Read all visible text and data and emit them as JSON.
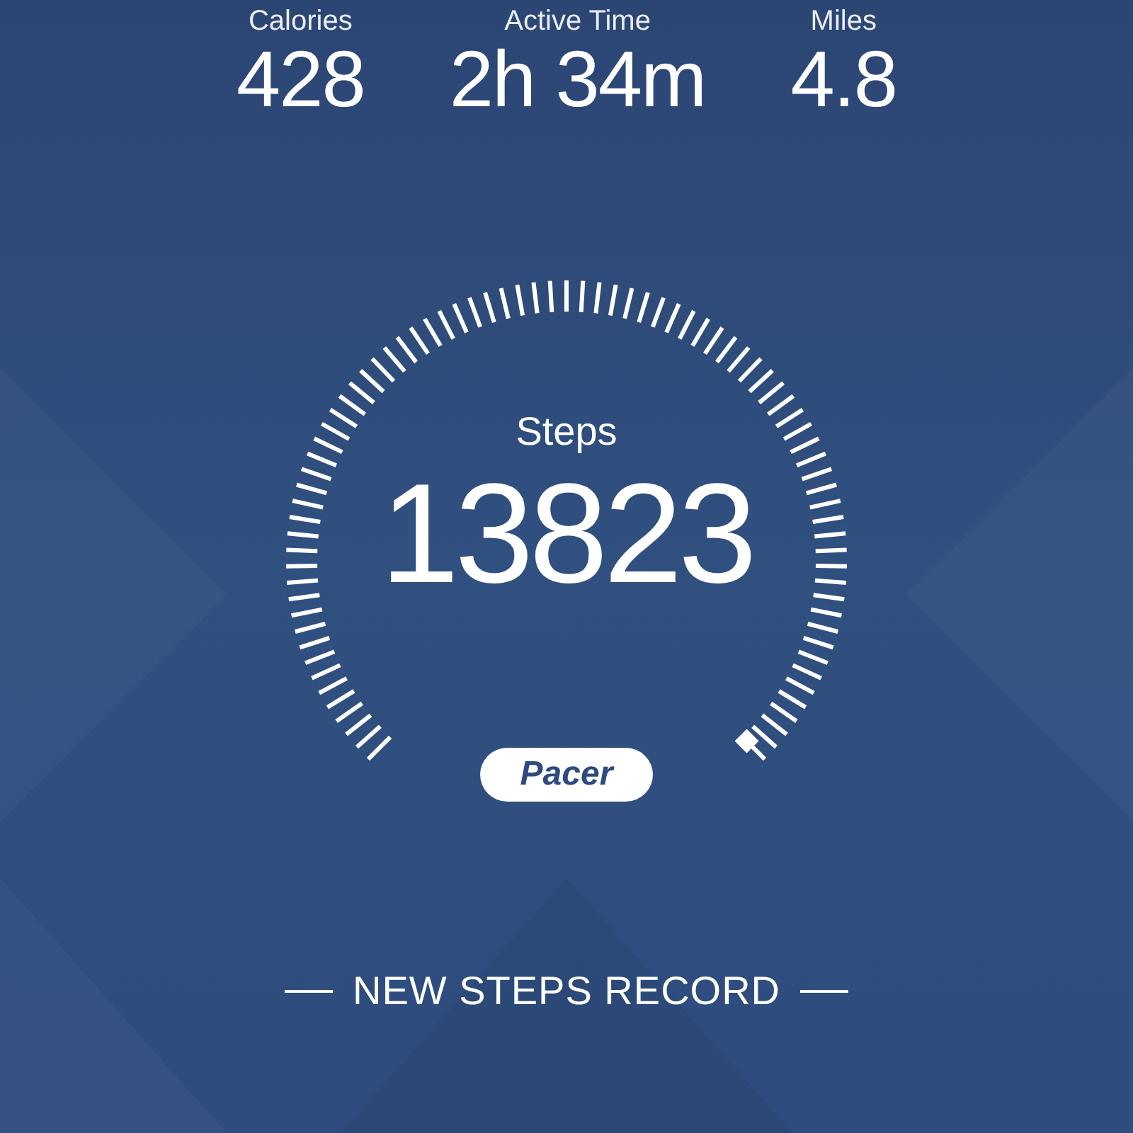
{
  "stats": [
    {
      "label": "Calories",
      "value": "428"
    },
    {
      "label": "Active Time",
      "value": "2h 34m"
    },
    {
      "label": "Miles",
      "value": "4.8"
    }
  ],
  "gauge": {
    "label": "Steps",
    "value": "13823",
    "logo": "Pacer"
  },
  "record": "NEW STEPS RECORD"
}
